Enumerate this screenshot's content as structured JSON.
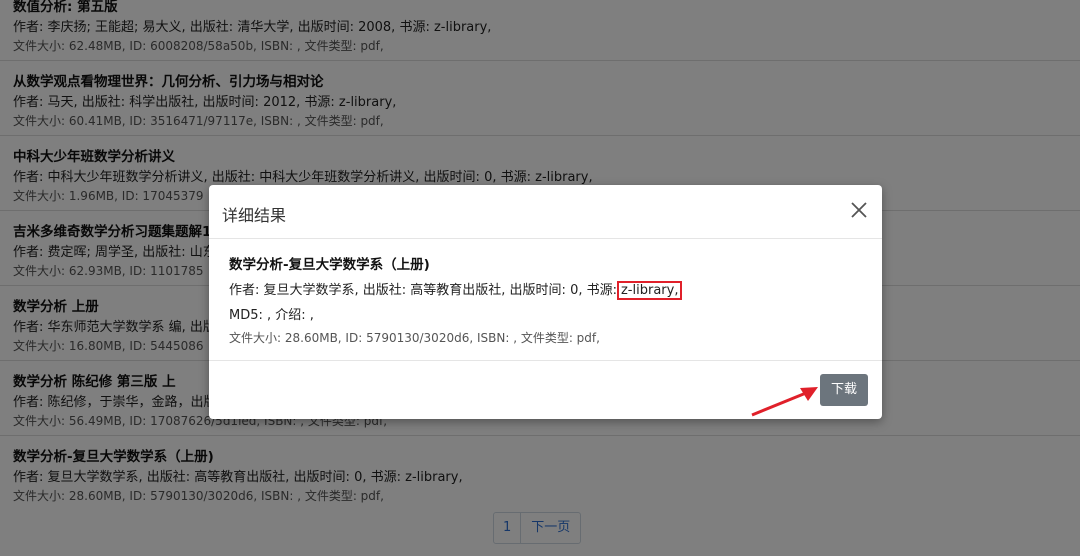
{
  "results": [
    {
      "title": "数值分析: 第五版",
      "authors": "作者: 李庆扬; 王能超; 易大义, 出版社: 清华大学, 出版时间: 2008, 书源: z-library,",
      "meta": "文件大小:  62.48MB, ID:  6008208/58a50b, ISBN:  , 文件类型:  pdf,"
    },
    {
      "title": "从数学观点看物理世界：几何分析、引力场与相对论",
      "authors": "作者: 马天, 出版社: 科学出版社, 出版时间: 2012, 书源: z-library,",
      "meta": "文件大小:  60.41MB, ID:  3516471/97117e, ISBN:  , 文件类型:  pdf,"
    },
    {
      "title": "中科大少年班数学分析讲义",
      "authors": "作者: 中科大少年班数学分析讲义, 出版社: 中科大少年班数学分析讲义, 出版时间: 0, 书源: z-library,",
      "meta": "文件大小:  1.96MB, ID:  17045379"
    },
    {
      "title": "吉米多维奇数学分析习题集题解1",
      "authors": "作者: 费定晖; 周学圣, 出版社: 山东",
      "meta": "文件大小:  62.93MB, ID:  1101785"
    },
    {
      "title": "数学分析 上册",
      "authors": "作者: 华东师范大学数学系 编, 出版",
      "meta": "文件大小:  16.80MB, ID:  5445086"
    },
    {
      "title": "数学分析 陈纪修 第三版 上",
      "authors": "作者: 陈纪修，于崇华，金路，出版",
      "meta": "文件大小:  56.49MB, ID:  17087626/5d1led, ISBN:  , 文件类型:  pdf,"
    },
    {
      "title": "数学分析-复旦大学数学系（上册)",
      "authors": "作者: 复旦大学数学系, 出版社: 高等教育出版社, 出版时间: 0, 书源: z-library,",
      "meta": "文件大小:  28.60MB, ID:  5790130/3020d6, ISBN:  , 文件类型:  pdf,"
    }
  ],
  "pagination": {
    "current": "1",
    "next": "下一页"
  },
  "modal": {
    "title": "详细结果",
    "book_title": "数学分析-复旦大学数学系（上册)",
    "authors_prefix": "作者: 复旦大学数学系, 出版社: 高等教育出版社, 出版时间: 0, 书源:",
    "source": "z-library,",
    "extra": "MD5:  , 介绍:  ,",
    "meta": "文件大小:  28.60MB, ID:  5790130/3020d6, ISBN:  , 文件类型:  pdf,",
    "download_label": "下载"
  },
  "colors": {
    "highlight": "#e0202a",
    "download_button": "#6c757d",
    "link": "#2d6fd2"
  }
}
